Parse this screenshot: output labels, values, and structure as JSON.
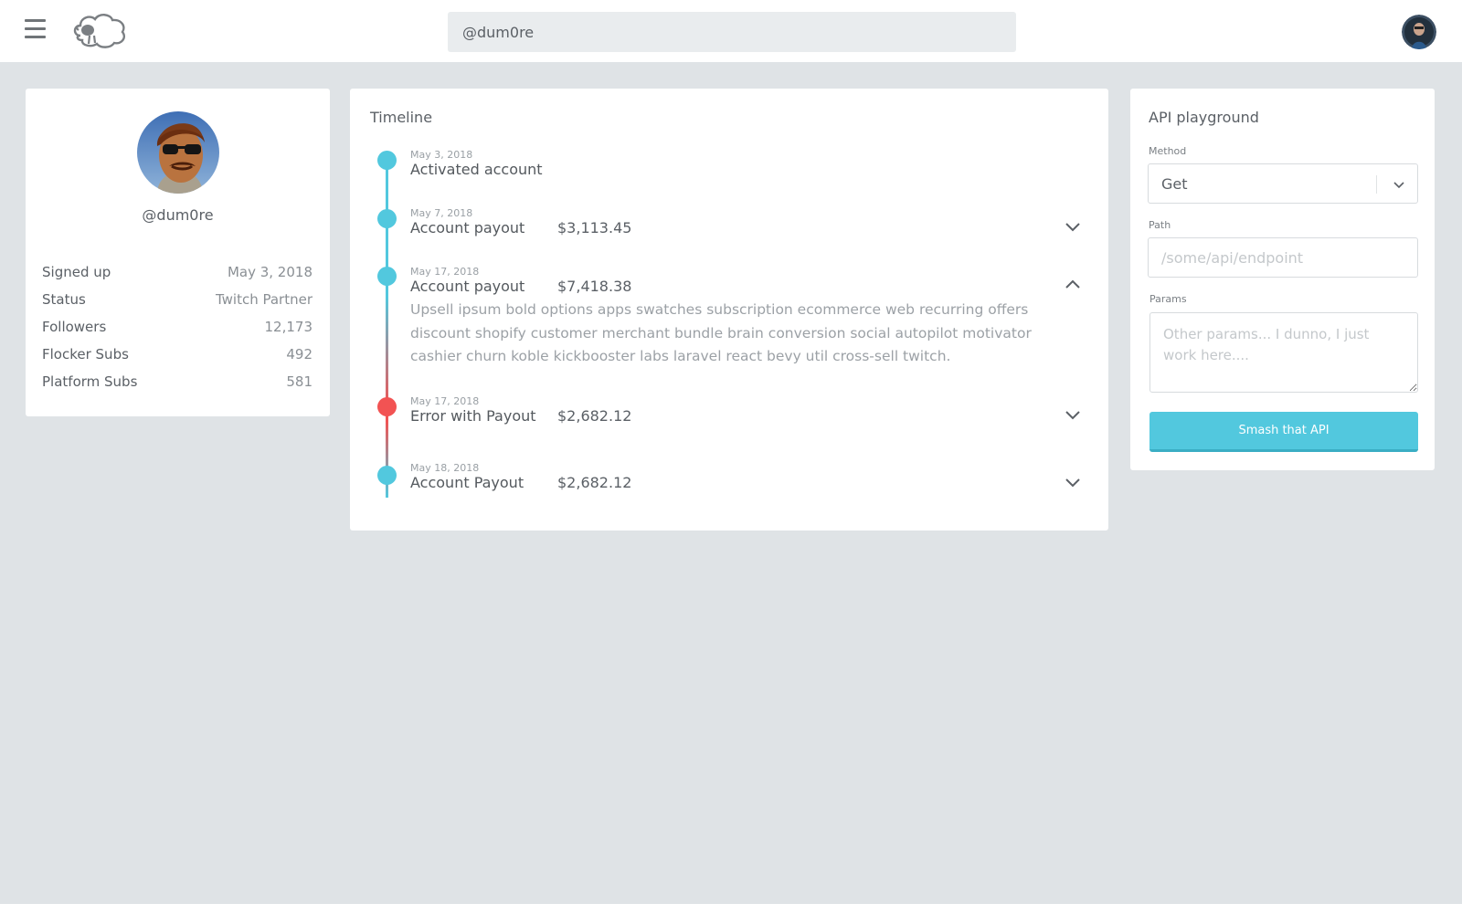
{
  "topbar": {
    "menu_icon": "hamburger-menu-icon",
    "logo_icon": "sheep-cloud-logo",
    "search_value": "@dum0re",
    "user_avatar_icon": "user-avatar"
  },
  "profile": {
    "handle": "@dum0re",
    "avatar_icon": "profile-avatar",
    "stats": [
      {
        "label": "Signed up",
        "value": "May 3, 2018"
      },
      {
        "label": "Status",
        "value": "Twitch Partner"
      },
      {
        "label": "Followers",
        "value": "12,173"
      },
      {
        "label": "Flocker Subs",
        "value": "492"
      },
      {
        "label": "Platform Subs",
        "value": "581"
      }
    ]
  },
  "timeline": {
    "title": "Timeline",
    "events": [
      {
        "date": "May 3, 2018",
        "label": "Activated account",
        "amount": "",
        "status": "ok",
        "expanded": false
      },
      {
        "date": "May 7, 2018",
        "label": "Account payout",
        "amount": "$3,113.45",
        "status": "ok",
        "expanded": false
      },
      {
        "date": "May 17, 2018",
        "label": "Account payout",
        "amount": "$7,418.38",
        "status": "ok",
        "expanded": true,
        "description": "Upsell ipsum bold options apps swatches subscription ecommerce web recurring offers discount shopify customer merchant bundle brain conversion social autopilot motivator cashier churn koble kickbooster labs laravel react bevy util cross-sell twitch."
      },
      {
        "date": "May 17, 2018",
        "label": "Error with Payout",
        "amount": "$2,682.12",
        "status": "error",
        "expanded": false
      },
      {
        "date": "May 18, 2018",
        "label": "Account Payout",
        "amount": "$2,682.12",
        "status": "ok",
        "expanded": false
      }
    ],
    "colors": {
      "ok": "#52c8de",
      "error": "#f25353"
    }
  },
  "api": {
    "title": "API playground",
    "method_label": "Method",
    "method_value": "Get",
    "path_label": "Path",
    "path_placeholder": "/some/api/endpoint",
    "params_label": "Params",
    "params_placeholder": "Other params... I dunno, I just work here....",
    "button_label": "Smash that API",
    "accent_color": "#52c8de"
  }
}
